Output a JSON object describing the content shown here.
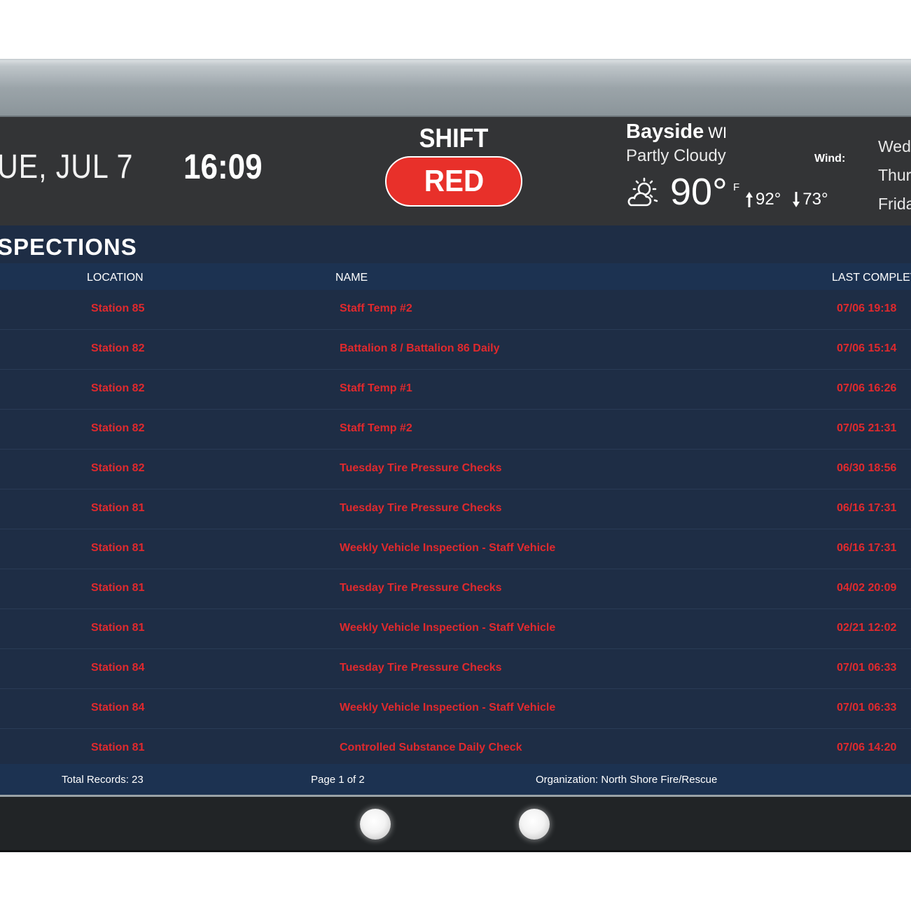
{
  "header": {
    "date": "UE, JUL 7",
    "time": "16:09",
    "shift_label": "SHIFT",
    "shift_value": "RED",
    "shift_color": "#e8302a"
  },
  "weather": {
    "city": "Bayside",
    "state": "WI",
    "condition": "Partly Cloudy",
    "icon": "partly-cloudy-icon",
    "temperature": "90°",
    "unit": "F",
    "high": "92°",
    "low": "73°",
    "wind_label": "Wind:",
    "forecast": [
      "Wedr",
      "Thurs",
      "Frida"
    ]
  },
  "board": {
    "title": "SPECTIONS",
    "columns": [
      "LOCATION",
      "NAME",
      "LAST COMPLETE"
    ],
    "rows": [
      {
        "location": "Station 85",
        "name": "Staff Temp #2",
        "last": "07/06 19:18"
      },
      {
        "location": "Station 82",
        "name": "Battalion 8 / Battalion 86 Daily",
        "last": "07/06 15:14"
      },
      {
        "location": "Station 82",
        "name": "Staff Temp #1",
        "last": "07/06 16:26"
      },
      {
        "location": "Station 82",
        "name": "Staff Temp #2",
        "last": "07/05 21:31"
      },
      {
        "location": "Station 82",
        "name": "Tuesday Tire Pressure Checks",
        "last": "06/30 18:56"
      },
      {
        "location": "Station 81",
        "name": "Tuesday Tire Pressure Checks",
        "last": "06/16 17:31"
      },
      {
        "location": "Station 81",
        "name": "Weekly Vehicle Inspection - Staff Vehicle",
        "last": "06/16 17:31"
      },
      {
        "location": "Station 81",
        "name": "Tuesday Tire Pressure Checks",
        "last": "04/02 20:09"
      },
      {
        "location": "Station 81",
        "name": "Weekly Vehicle Inspection - Staff Vehicle",
        "last": "02/21 12:02"
      },
      {
        "location": "Station 84",
        "name": "Tuesday Tire Pressure Checks",
        "last": "07/01 06:33"
      },
      {
        "location": "Station 84",
        "name": "Weekly Vehicle Inspection - Staff Vehicle",
        "last": "07/01 06:33"
      },
      {
        "location": "Station 81",
        "name": "Controlled Substance Daily Check",
        "last": "07/06 14:20"
      }
    ],
    "overdue_color": "#e0292d"
  },
  "footer": {
    "total": "Total Records: 23",
    "page": "Page 1 of 2",
    "organization": "Organization: North Shore Fire/Rescue"
  }
}
